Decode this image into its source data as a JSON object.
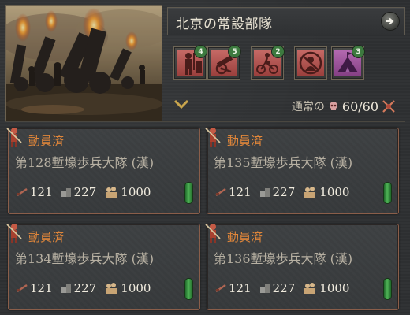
{
  "header": {
    "title": "北京の常設部隊",
    "status_label": "通常の",
    "status_value": "60/60"
  },
  "icon_row": [
    {
      "name": "infantry",
      "icon": "soldier-icon",
      "count": "4",
      "color": "#b8524f"
    },
    {
      "name": "artillery",
      "icon": "cannon-icon",
      "count": "5",
      "color": "#b8524f"
    },
    {
      "name": "cavalry",
      "icon": "bicycle-icon",
      "count": "2",
      "color": "#b8524f"
    },
    {
      "name": "no-general",
      "icon": "no-general-icon",
      "count": "",
      "color": "#b8524f"
    },
    {
      "name": "camp",
      "icon": "tent-icon",
      "count": "3",
      "color": "#a454a2"
    }
  ],
  "units": [
    {
      "status": "動員済",
      "name": "第128塹壕歩兵大隊 (漢)",
      "manpower": "121",
      "supplies": "227",
      "strength": "1000"
    },
    {
      "status": "動員済",
      "name": "第135塹壕歩兵大隊 (漢)",
      "manpower": "121",
      "supplies": "227",
      "strength": "1000"
    },
    {
      "status": "動員済",
      "name": "第134塹壕歩兵大隊 (漢)",
      "manpower": "121",
      "supplies": "227",
      "strength": "1000"
    },
    {
      "status": "動員済",
      "name": "第136塹壕歩兵大隊 (漢)",
      "manpower": "121",
      "supplies": "227",
      "strength": "1000"
    }
  ],
  "colors": {
    "mobilized": "#e0863a",
    "card_border": "#8a5e4a",
    "ready_indicator": "#4fb356"
  }
}
